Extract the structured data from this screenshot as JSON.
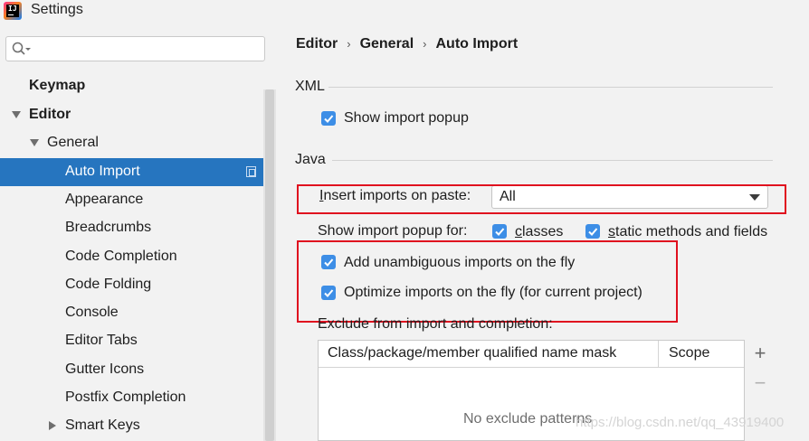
{
  "window": {
    "title": "Settings"
  },
  "sidebar": {
    "search_placeholder": "",
    "items": [
      {
        "label": "Keymap"
      },
      {
        "label": "Editor"
      },
      {
        "label": "General"
      },
      {
        "label": "Auto Import"
      },
      {
        "label": "Appearance"
      },
      {
        "label": "Breadcrumbs"
      },
      {
        "label": "Code Completion"
      },
      {
        "label": "Code Folding"
      },
      {
        "label": "Console"
      },
      {
        "label": "Editor Tabs"
      },
      {
        "label": "Gutter Icons"
      },
      {
        "label": "Postfix Completion"
      },
      {
        "label": "Smart Keys"
      }
    ]
  },
  "breadcrumb": {
    "part1": "Editor",
    "part2": "General",
    "part3": "Auto Import",
    "separator": "›"
  },
  "xml": {
    "section_title": "XML",
    "show_import_popup": {
      "label": "Show import popup",
      "checked": true
    }
  },
  "java": {
    "section_title": "Java",
    "insert_imports": {
      "label_first": "I",
      "label_rest": "nsert imports on paste:",
      "value": "All"
    },
    "show_popup_for": {
      "label": "Show import popup for:",
      "classes": {
        "label_first": "c",
        "label_rest": "lasses",
        "checked": true
      },
      "static": {
        "label_first": "s",
        "label_rest": "tatic methods and fields",
        "checked": true
      }
    },
    "add_unambiguous": {
      "label": "Add unambiguous imports on the fly",
      "checked": true
    },
    "optimize_imports": {
      "label": "Optimize imports on the fly (for current project)",
      "checked": true
    },
    "exclude": {
      "label": "Exclude from import and completion:",
      "columns": [
        "Class/package/member qualified name mask",
        "Scope"
      ],
      "empty_text": "No exclude patterns",
      "add_label": "+",
      "remove_label": "−"
    }
  },
  "watermark": "https://blog.csdn.net/qq_43919400",
  "colors": {
    "selection": "#2675bf",
    "checkbox": "#3d8ee6",
    "highlight_box": "#e0101f"
  }
}
